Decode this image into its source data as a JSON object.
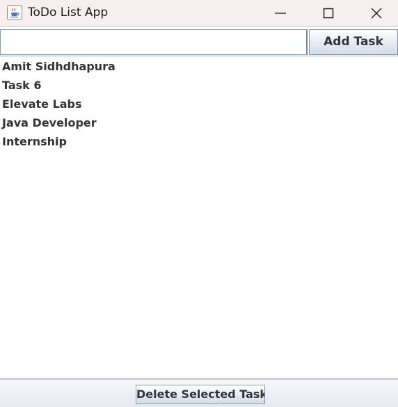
{
  "window": {
    "title": "ToDo List App",
    "icon": "java-cup-icon"
  },
  "controls": {
    "minimize_icon": "minimize-icon",
    "maximize_icon": "maximize-icon",
    "close_icon": "close-icon"
  },
  "input": {
    "value": "",
    "add_button_label": "Add Task"
  },
  "tasks": [
    {
      "label": "Amit Sidhdhapura"
    },
    {
      "label": "Task 6"
    },
    {
      "label": "Elevate Labs"
    },
    {
      "label": "Java Developer"
    },
    {
      "label": "Internship"
    }
  ],
  "footer": {
    "delete_button_label": "Delete Selected Task"
  },
  "colors": {
    "titlebar_bg": "#f5efef",
    "text": "#333333",
    "button_border": "#8b98a8"
  }
}
